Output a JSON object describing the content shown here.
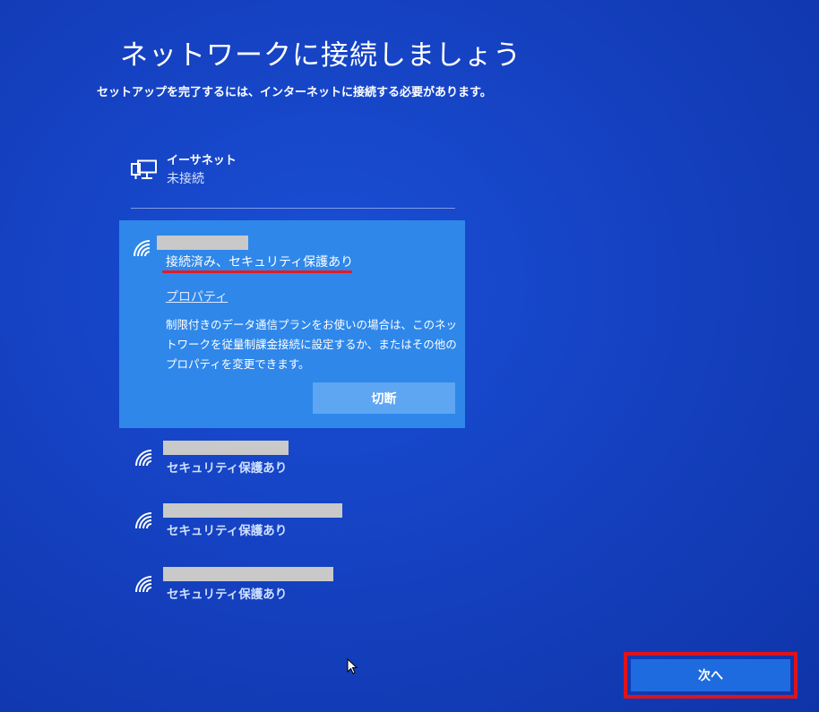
{
  "header": {
    "title": "ネットワークに接続しましょう",
    "subtitle": "セットアップを完了するには、インターネットに接続する必要があります。"
  },
  "ethernet": {
    "icon": "ethernet-icon",
    "name": "イーサネット",
    "status": "未接続"
  },
  "selected_network": {
    "icon": "wifi-icon",
    "status": "接続済み、セキュリティ保護あり",
    "properties_link": "プロパティ",
    "description": "制限付きのデータ通信プランをお使いの場合は、このネットワークを従量制課金接続に設定するか、またはその他のプロパティを変更できます。",
    "disconnect_label": "切断"
  },
  "networks": [
    {
      "icon": "wifi-icon",
      "status": "セキュリティ保護あり"
    },
    {
      "icon": "wifi-icon",
      "status": "セキュリティ保護あり"
    },
    {
      "icon": "wifi-icon",
      "status": "セキュリティ保護あり"
    }
  ],
  "footer": {
    "next_label": "次へ"
  },
  "colors": {
    "background": "#1542c2",
    "selected_card": "#2f87ea",
    "disconnect_button": "#5ea5f2",
    "next_button": "#1e6be0",
    "highlight_red": "#e31b23",
    "redaction": "#c9c9c9"
  }
}
